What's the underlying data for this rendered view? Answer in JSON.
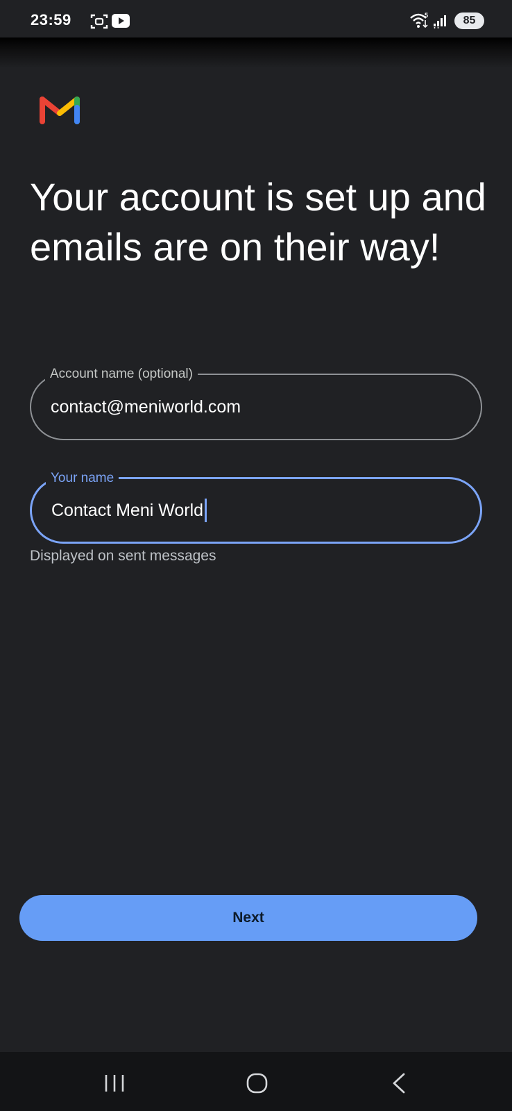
{
  "status_bar": {
    "time": "23:59",
    "battery": "85",
    "icons": [
      "screenshot-icon",
      "youtube-icon",
      "wifi-icon",
      "signal-icon",
      "battery-icon"
    ]
  },
  "logo": {
    "icon": "gmail-logo"
  },
  "heading": "Your account is set up and emails are on their way!",
  "account_field": {
    "label": "Account name (optional)",
    "value": "contact@meniworld.com"
  },
  "name_field": {
    "label": "Your name",
    "value": "Contact Meni World",
    "helper": "Displayed on sent messages",
    "focused": true
  },
  "next_button": {
    "label": "Next"
  },
  "nav_bar": {
    "items": [
      "recent-apps-icon",
      "home-icon",
      "back-icon"
    ]
  },
  "colors": {
    "background": "#202124",
    "accent": "#7ba4f7",
    "button": "#669df6"
  }
}
